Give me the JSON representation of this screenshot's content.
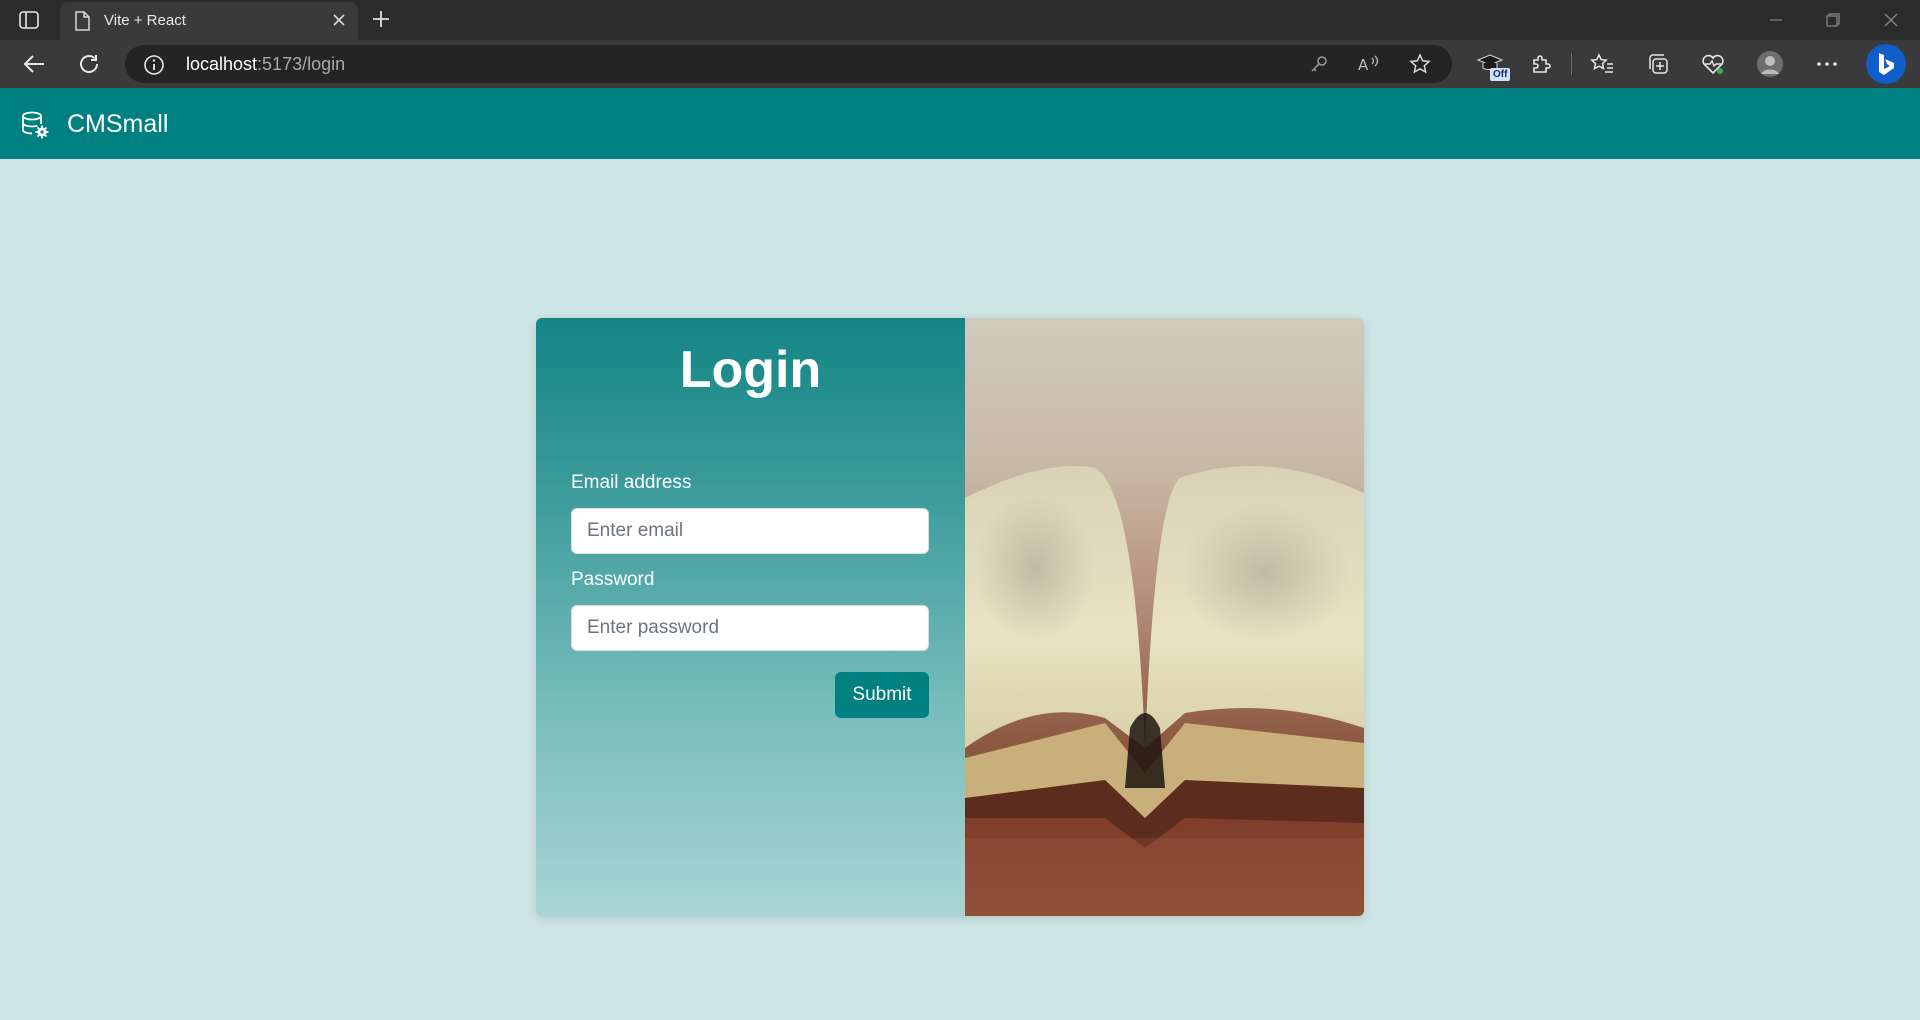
{
  "browser": {
    "tab_title": "Vite + React",
    "url_host": "localhost",
    "url_rest": ":5173/login",
    "extension_badge": "Off"
  },
  "app": {
    "brand": "CMSmall"
  },
  "login": {
    "title": "Login",
    "email_label": "Email address",
    "email_placeholder": "Enter email",
    "password_label": "Password",
    "password_placeholder": "Enter password",
    "submit_label": "Submit"
  },
  "colors": {
    "brand_teal": "#008080",
    "page_background": "#cde5e5"
  }
}
